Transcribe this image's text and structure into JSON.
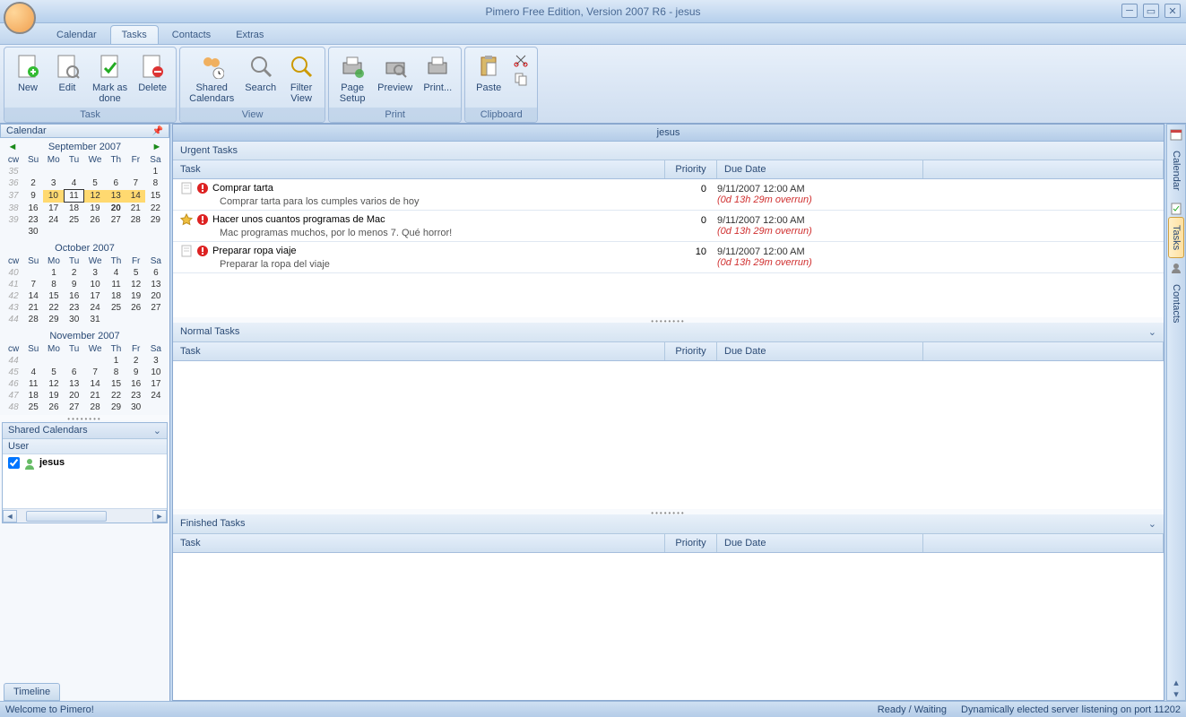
{
  "app_title": "Pimero Free Edition, Version 2007 R6 - jesus",
  "menu_tabs": {
    "calendar": "Calendar",
    "tasks": "Tasks",
    "contacts": "Contacts",
    "extras": "Extras"
  },
  "ribbon": {
    "task_group": "Task",
    "view_group": "View",
    "print_group": "Print",
    "clipboard_group": "Clipboard",
    "new": "New",
    "edit": "Edit",
    "mark_done": "Mark as\ndone",
    "delete": "Delete",
    "shared_cal": "Shared\nCalendars",
    "search": "Search",
    "filter_view": "Filter\nView",
    "page_setup": "Page\nSetup",
    "preview": "Preview",
    "print": "Print...",
    "paste": "Paste"
  },
  "left": {
    "header": "Calendar",
    "months": {
      "sep": {
        "title": "September 2007",
        "cw": [
          "35",
          "36",
          "37",
          "38",
          "39"
        ],
        "rows": [
          [
            "",
            "",
            "",
            "",
            "",
            "",
            "1"
          ],
          [
            "2",
            "3",
            "4",
            "5",
            "6",
            "7",
            "8"
          ],
          [
            "9",
            "10",
            "11",
            "12",
            "13",
            "14",
            "15"
          ],
          [
            "16",
            "17",
            "18",
            "19",
            "20",
            "21",
            "22"
          ],
          [
            "23",
            "24",
            "25",
            "26",
            "27",
            "28",
            "29"
          ],
          [
            "30",
            "",
            "",
            "",
            "",
            "",
            ""
          ]
        ]
      },
      "oct": {
        "title": "October 2007",
        "cw": [
          "40",
          "41",
          "42",
          "43",
          "44"
        ],
        "rows": [
          [
            "",
            "1",
            "2",
            "3",
            "4",
            "5",
            "6"
          ],
          [
            "7",
            "8",
            "9",
            "10",
            "11",
            "12",
            "13"
          ],
          [
            "14",
            "15",
            "16",
            "17",
            "18",
            "19",
            "20"
          ],
          [
            "21",
            "22",
            "23",
            "24",
            "25",
            "26",
            "27"
          ],
          [
            "28",
            "29",
            "30",
            "31",
            "",
            "",
            ""
          ]
        ]
      },
      "nov": {
        "title": "November 2007",
        "cw": [
          "44",
          "45",
          "46",
          "47",
          "48"
        ],
        "rows": [
          [
            "",
            "",
            "",
            "",
            "1",
            "2",
            "3"
          ],
          [
            "4",
            "5",
            "6",
            "7",
            "8",
            "9",
            "10"
          ],
          [
            "11",
            "12",
            "13",
            "14",
            "15",
            "16",
            "17"
          ],
          [
            "18",
            "19",
            "20",
            "21",
            "22",
            "23",
            "24"
          ],
          [
            "25",
            "26",
            "27",
            "28",
            "29",
            "30",
            ""
          ]
        ]
      }
    },
    "days": [
      "cw",
      "Su",
      "Mo",
      "Tu",
      "We",
      "Th",
      "Fr",
      "Sa"
    ],
    "shared_header": "Shared Calendars",
    "user_header": "User",
    "user_name": "jesus",
    "timeline": "Timeline"
  },
  "center": {
    "title": "jesus",
    "urgent_header": "Urgent Tasks",
    "normal_header": "Normal Tasks",
    "finished_header": "Finished Tasks",
    "cols": {
      "task": "Task",
      "priority": "Priority",
      "due": "Due Date"
    },
    "tasks": [
      {
        "star": false,
        "title": "Comprar tarta",
        "desc": "Comprar tarta para los cumples varios de hoy",
        "priority": "0",
        "due": "9/11/2007 12:00 AM",
        "overrun": "(0d 13h 29m overrun)"
      },
      {
        "star": true,
        "title": "Hacer unos cuantos programas de Mac",
        "desc": "Mac programas muchos, por lo menos 7. Qué horror!",
        "priority": "0",
        "due": "9/11/2007 12:00 AM",
        "overrun": "(0d 13h 29m overrun)"
      },
      {
        "star": false,
        "title": "Preparar ropa viaje",
        "desc": "Preparar la ropa del viaje",
        "priority": "10",
        "due": "9/11/2007 12:00 AM",
        "overrun": "(0d 13h 29m overrun)"
      }
    ]
  },
  "right_tabs": {
    "calendar": "Calendar",
    "tasks": "Tasks",
    "contacts": "Contacts"
  },
  "status": {
    "left": "Welcome to Pimero!",
    "ready": "Ready / Waiting",
    "server": "Dynamically elected server listening on port 11202"
  }
}
